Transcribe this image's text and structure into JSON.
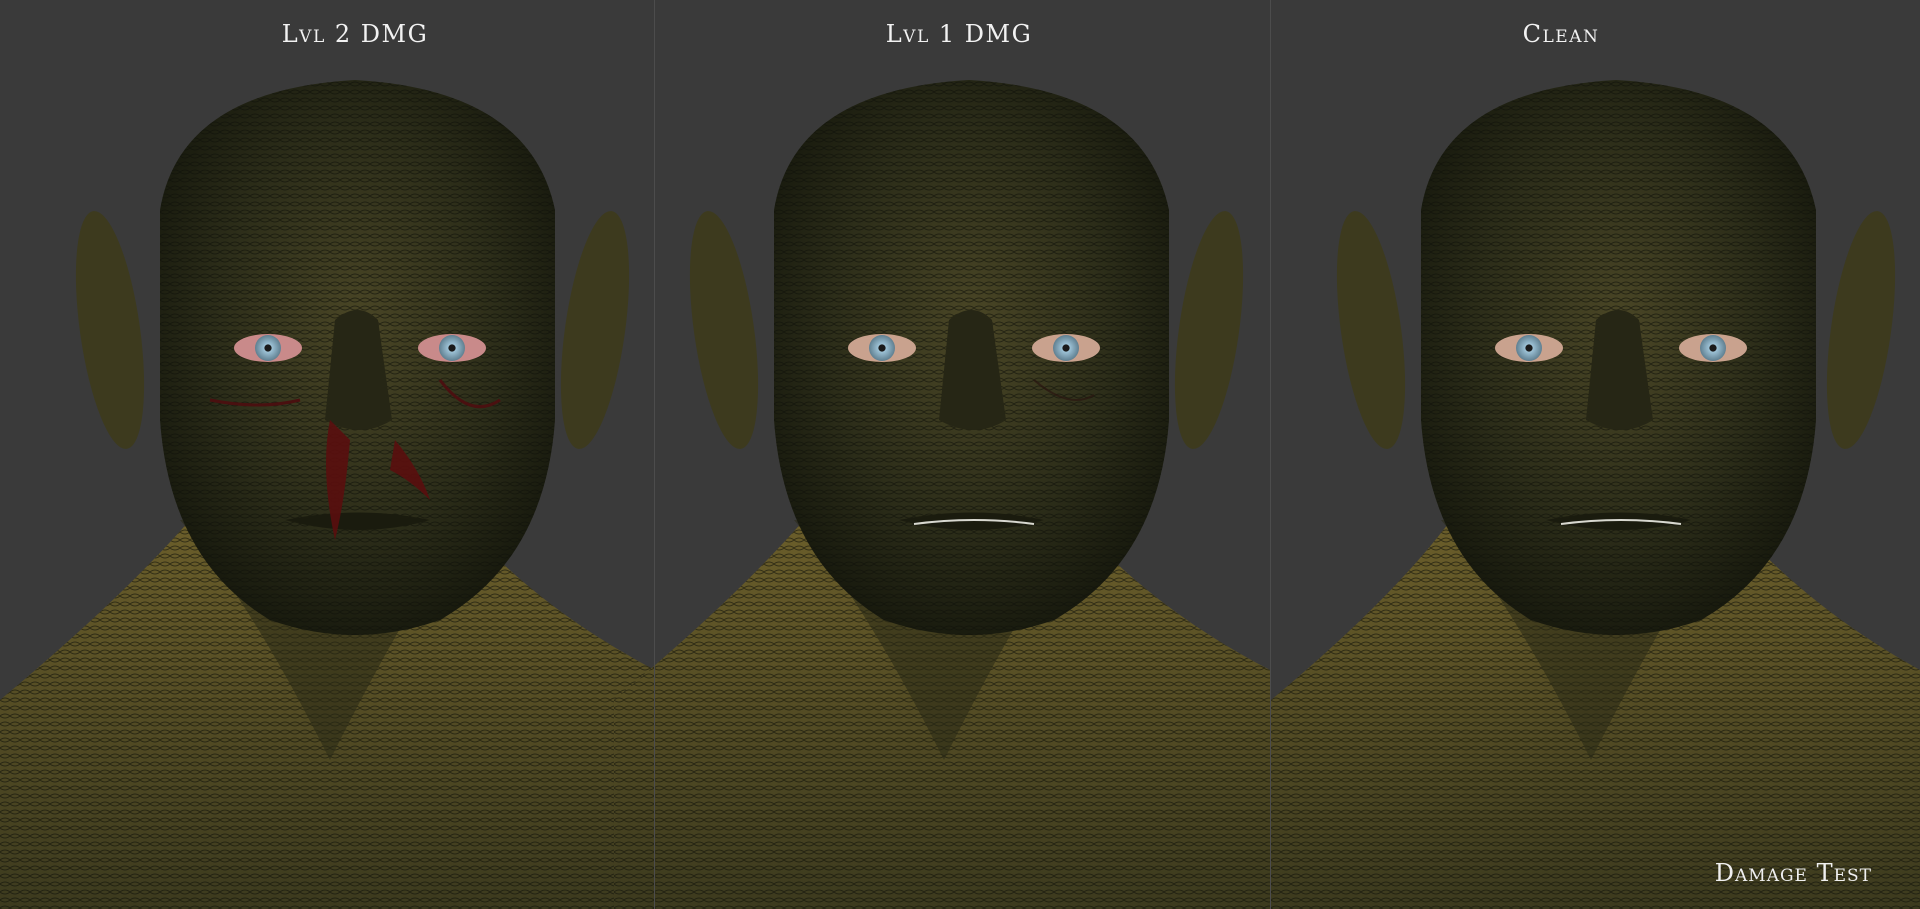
{
  "captions": {
    "left": "Lvl 2 DMG",
    "center": "Lvl 1 DMG",
    "right": "Clean"
  },
  "watermark": "Damage Test",
  "colors": {
    "background": "#3a3a3a",
    "skin_dark": "#1f2212",
    "skin_mid": "#4a4524",
    "skin_light": "#7a6a33",
    "eye_iris": "#8fb4c9",
    "blood": "#5a0e0e"
  }
}
